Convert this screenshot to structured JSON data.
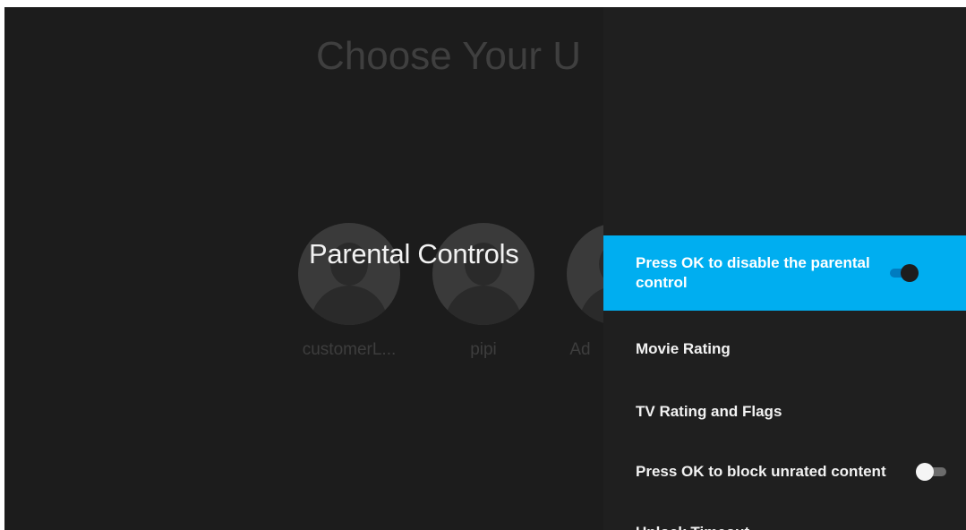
{
  "background": {
    "title": "Choose Your U",
    "profiles": [
      {
        "name": "customerL..."
      },
      {
        "name": "pipi"
      },
      {
        "name": "Ad"
      }
    ]
  },
  "overlay_title": "Parental Controls",
  "panel": {
    "items": [
      {
        "label": "Press OK to disable the parental control",
        "toggle": "on",
        "focused": true
      },
      {
        "label": "Movie Rating"
      },
      {
        "label": "TV Rating and Flags"
      },
      {
        "label": "Press OK to block unrated content",
        "toggle": "off"
      },
      {
        "label": "Unlock Timeout"
      }
    ]
  },
  "colors": {
    "accent": "#00aef0",
    "background": "#1c1c1c",
    "panel": "#1f1f1f"
  }
}
